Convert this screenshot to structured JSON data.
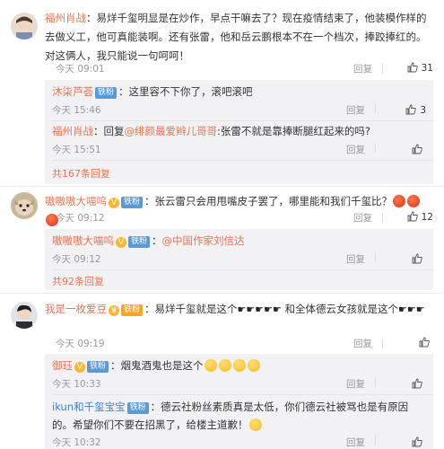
{
  "comments": [
    {
      "user": "福州肖战",
      "text": "：易烊千玺明显是在炒作，早点干嘛去了？现在疫情结束了，他装模作样的去做义工，他可真能装啊。还有张雷，他和岳云鹏根本不在一个档次，捧跤捧红的。对这俩人，我只能说一句呵呵！",
      "time": "今天 09:01",
      "reply_label": "回复",
      "likes": "31",
      "replies": [
        {
          "user": "沐柒芦荟",
          "badge": "铁粉",
          "text": "：这里容不下你了，滚吧滚吧",
          "time": "今天 15:46",
          "reply_label": "回复",
          "likes": "3"
        },
        {
          "user": "福州肖战",
          "reply_prefix": "：回复",
          "mention": "@绯颜最爱辫儿哥哥",
          "text": ":张雷不就是靠捧断腿红起来的吗?",
          "time": "今天 15:51",
          "reply_label": "回复",
          "likes": ""
        }
      ],
      "more": "共167条回复"
    },
    {
      "user": "嗷嗷嗷大喵呜",
      "badge": "铁粉",
      "text": "：张云雷只会用甩嘴皮子罢了，哪里能和我们千玺比？",
      "time": "今天 09:12",
      "reply_label": "回复",
      "likes": "12",
      "replies": [
        {
          "user": "嗷嗷嗷大喵呜",
          "badge": "铁粉",
          "mention": "@中国作家刘信达",
          "text": "：",
          "time": "今天 09:12",
          "reply_label": "回复",
          "likes": ""
        }
      ],
      "more": "共92条回复"
    },
    {
      "user": "我是一枚爱豆",
      "badge": "铁粉",
      "text": "：易烊千玺就是这个",
      "text2": "和全体德云女孩就是这个",
      "time": "今天 09:19",
      "reply_label": "回复",
      "likes": "",
      "replies": [
        {
          "user": "御珏",
          "badge": "铁粉",
          "text": "：烟鬼酒鬼也是这个",
          "time": "今天 10:33",
          "reply_label": "回复",
          "likes": ""
        },
        {
          "user": "ikun和千玺宝宝",
          "badge": "铁粉",
          "text": "：德云社粉丝素质真是太低，你们德云社被骂也是有原因的。希望你们不要在招黑了，给楼主道歉！",
          "time": "今天 10:32",
          "reply_label": "回复",
          "likes": ""
        }
      ]
    }
  ],
  "colors": {
    "accent": "#eb7350",
    "link_blue": "#3d7fcd",
    "meta": "#999999",
    "reply_bg": "#f2f2f5"
  }
}
